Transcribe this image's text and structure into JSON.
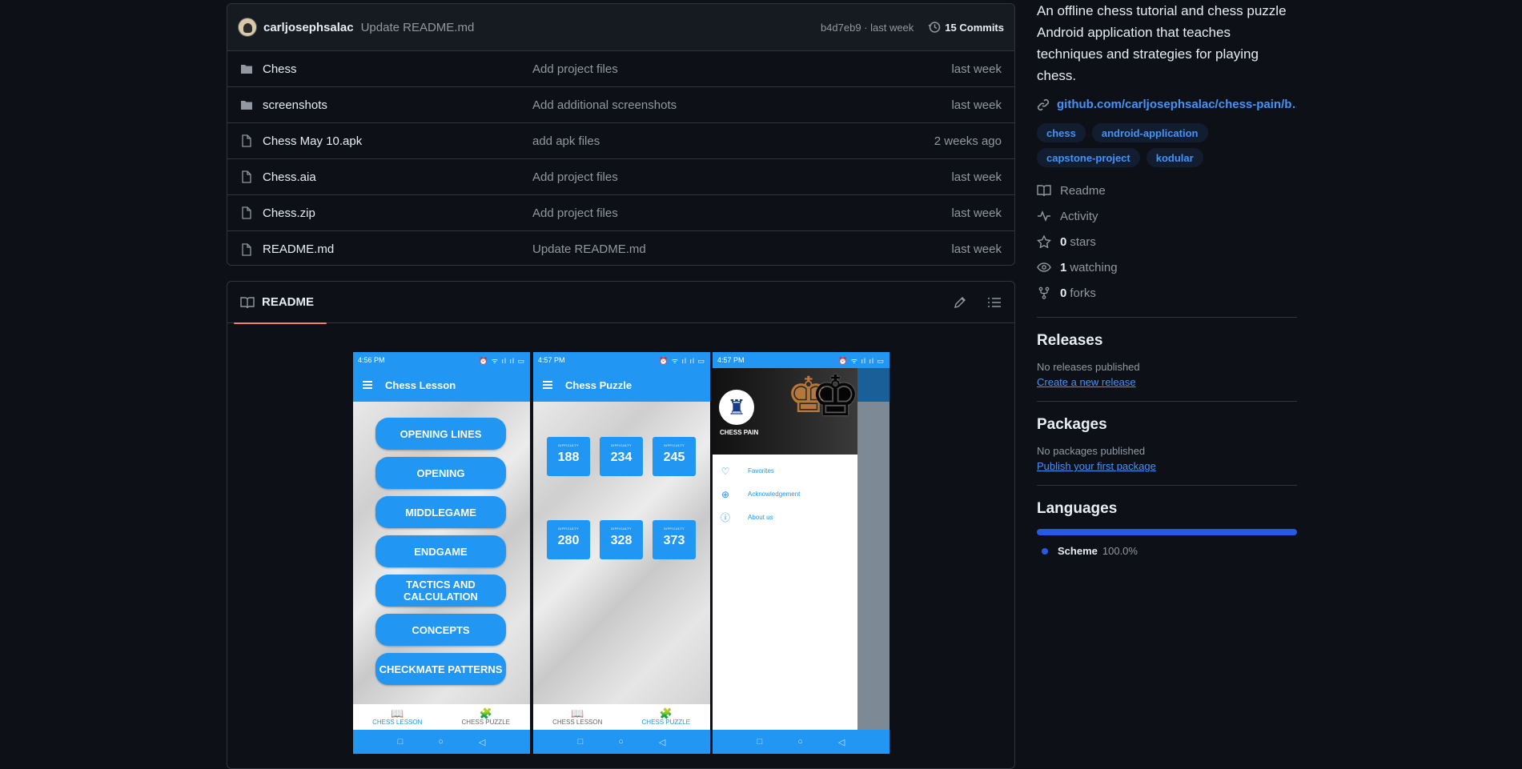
{
  "commit": {
    "author": "carljosephsalac",
    "message": "Update README.md",
    "hash_time": "b4d7eb9 · last week",
    "commits_label": "15 Commits"
  },
  "files": [
    {
      "name": "Chess",
      "type": "folder",
      "message": "Add project files",
      "time": "last week"
    },
    {
      "name": "screenshots",
      "type": "folder",
      "message": "Add additional screenshots",
      "time": "last week"
    },
    {
      "name": "Chess May 10.apk",
      "type": "file",
      "message": "add apk files",
      "time": "2 weeks ago"
    },
    {
      "name": "Chess.aia",
      "type": "file",
      "message": "Add project files",
      "time": "last week"
    },
    {
      "name": "Chess.zip",
      "type": "file",
      "message": "Add project files",
      "time": "last week"
    },
    {
      "name": "README.md",
      "type": "file",
      "message": "Update README.md",
      "time": "last week"
    }
  ],
  "readme": {
    "tab_label": "README",
    "phone1": {
      "time": "4:56 PM",
      "title": "Chess Lesson",
      "buttons": [
        "OPENING LINES",
        "OPENING",
        "MIDDLEGAME",
        "ENDGAME",
        "TACTICS AND CALCULATION",
        "CONCEPTS",
        "CHECKMATE PATTERNS"
      ],
      "nav": [
        "CHESS LESSON",
        "CHESS PUZZLE"
      ]
    },
    "phone2": {
      "time": "4:57 PM",
      "title": "Chess Puzzle",
      "tile_label": "DIFFICULTY",
      "tiles": [
        "188",
        "234",
        "245",
        "280",
        "328",
        "373"
      ],
      "nav": [
        "CHESS LESSON",
        "CHESS PUZZLE"
      ]
    },
    "phone3": {
      "time": "4:57 PM",
      "app_name": "CHESS PAIN",
      "menu": [
        "Favorites",
        "Acknowledgement",
        "About us"
      ]
    }
  },
  "sidebar": {
    "about": "An offline chess tutorial and chess puzzle Android application that teaches techniques and strategies for playing chess.",
    "link": "github.com/carljosephsalac/chess-pain/b…",
    "topics": [
      "chess",
      "android-application",
      "capstone-project",
      "kodular"
    ],
    "meta": {
      "readme": "Readme",
      "activity": "Activity",
      "stars_count": "0",
      "stars_label": "stars",
      "watching_count": "1",
      "watching_label": "watching",
      "forks_count": "0",
      "forks_label": "forks"
    },
    "releases": {
      "title": "Releases",
      "none": "No releases published",
      "action": "Create a new release"
    },
    "packages": {
      "title": "Packages",
      "none": "No packages published",
      "action": "Publish your first package"
    },
    "languages": {
      "title": "Languages",
      "name": "Scheme",
      "percent": "100.0%",
      "fraction": 1.0,
      "color": "#2759e6"
    }
  }
}
